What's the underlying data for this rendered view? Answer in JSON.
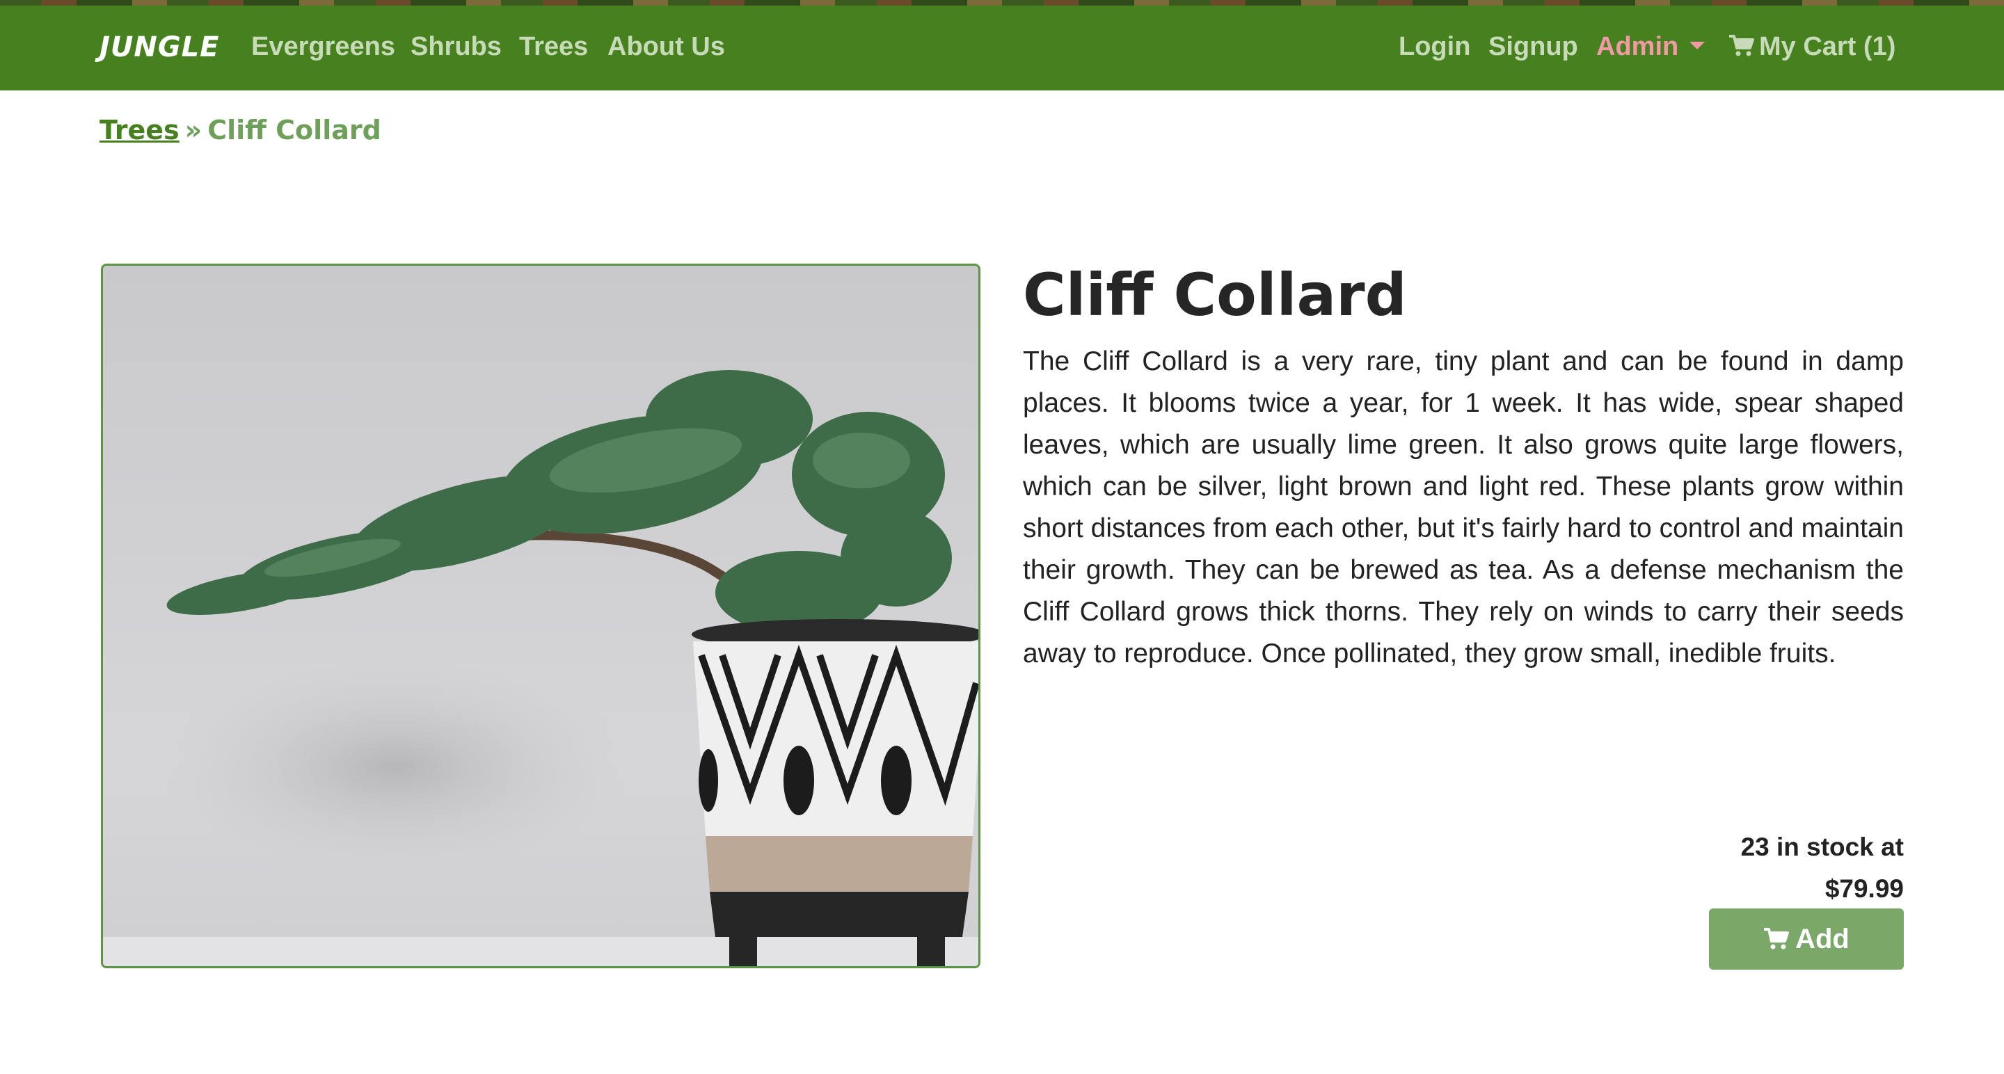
{
  "navbar": {
    "brand": "JUNGLE",
    "left_links": [
      "Evergreens",
      "Shrubs",
      "Trees",
      "About Us"
    ],
    "login": "Login",
    "signup": "Signup",
    "admin": "Admin",
    "cart": "My Cart (1)",
    "bg_color": "#47801f"
  },
  "breadcrumb": {
    "parent": "Trees",
    "separator": "»",
    "current": "Cliff Collard"
  },
  "product": {
    "name": "Cliff Collard",
    "description": "The Cliff Collard is a very rare, tiny plant and can be found in damp places. It blooms twice a year, for 1 week. It has wide, spear shaped leaves, which are usually lime green. It also grows quite large flowers, which can be silver, light brown and light red. These plants grow within short distances from each other, but it's fairly hard to control and maintain their growth. They can be brewed as tea. As a defense mechanism the Cliff Collard grows thick thorns. They rely on winds to carry their seeds away to reproduce. Once pollinated, they grow small, inedible fruits.",
    "stock_line": "23 in stock at",
    "price": "$79.99",
    "add_label": "Add"
  },
  "icons": {
    "cart": "shopping-cart-icon",
    "dropdown": "caret-down-icon"
  }
}
